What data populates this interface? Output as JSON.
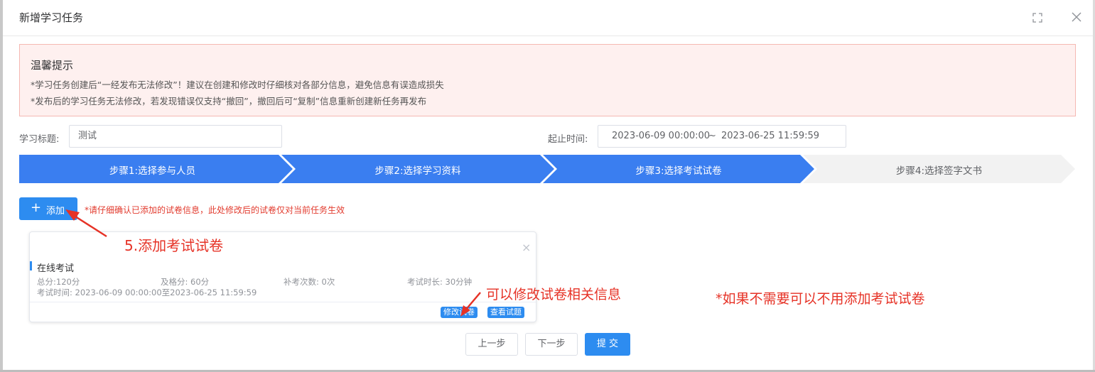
{
  "dialog": {
    "title": "新增学习任务"
  },
  "notice": {
    "title": "温馨提示",
    "line1": "*学习任务创建后“一经发布无法修改”！建议在创建和修改时仔细核对各部分信息，避免信息有误造成损失",
    "line2": "*发布后的学习任务无法修改，若发现错误仅支持“撤回”，撤回后可“复制”信息重新创建新任务再发布"
  },
  "form": {
    "title_label": "学习标题:",
    "title_value": "测试",
    "time_label": "起止时间:",
    "time_start": "2023-06-09 00:00:00",
    "time_separator": "~",
    "time_end": "2023-06-25 11:59:59"
  },
  "steps": [
    {
      "label": "步骤1:选择参与人员",
      "active": true
    },
    {
      "label": "步骤2:选择学习资料",
      "active": true
    },
    {
      "label": "步骤3:选择考试试卷",
      "active": true
    },
    {
      "label": "步骤4:选择签字文书",
      "active": false
    }
  ],
  "add": {
    "plus": "+",
    "label": "添加",
    "hint": "*请仔细确认已添加的试卷信息，此处修改后的试卷仅对当前任务生效"
  },
  "exam": {
    "name": "在线考试",
    "total": "总分:120分",
    "pass": "及格分: 60分",
    "makeup": "补考次数: 0次",
    "duration": "考试时长: 30分钟",
    "time": "考试时间: 2023-06-09 00:00:00至2023-06-25 11:59:59",
    "close": "×",
    "edit_label": "修改试卷",
    "view_label": "查看试题"
  },
  "annotations": {
    "a1": "5.添加考试试卷",
    "a2": "可以修改试卷相关信息",
    "a3": "*如果不需要可以不用添加考试试卷"
  },
  "footer": {
    "prev": "上一步",
    "next": "下一步",
    "submit": "提 交"
  },
  "colors": {
    "primary": "#2d8cf0",
    "step_active": "#3a7ef0",
    "step_inactive": "#f2f2f2",
    "annotation": "#e63226"
  }
}
